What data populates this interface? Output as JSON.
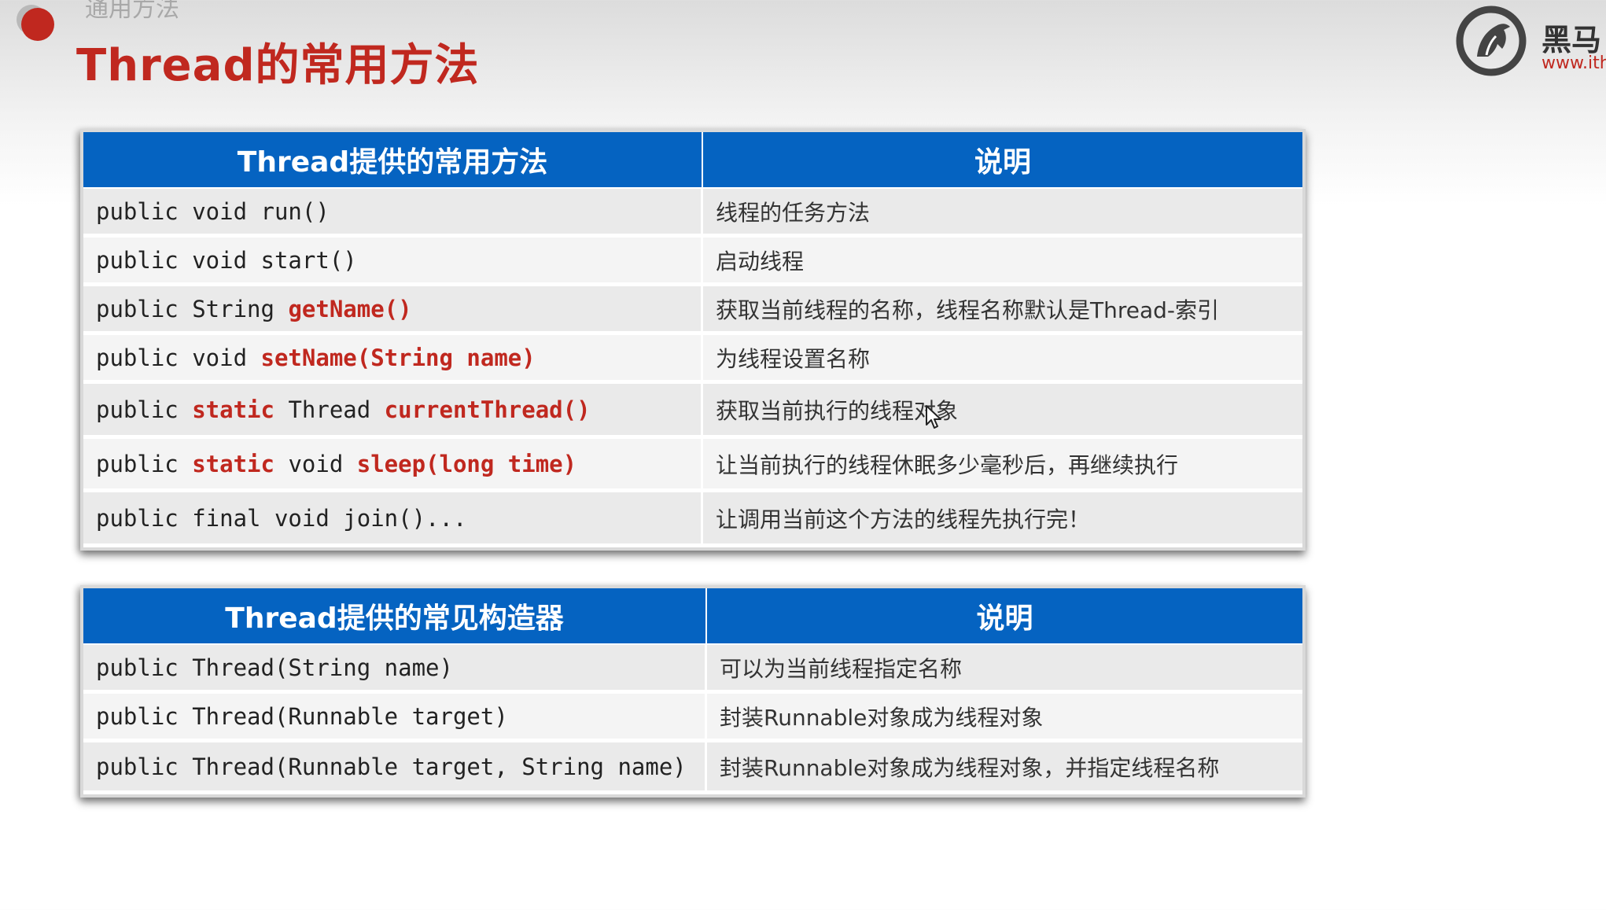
{
  "header": {
    "faded_text": "通用方法",
    "title": "Thread的常用方法"
  },
  "logo": {
    "name": "黑马",
    "url": "www.ith"
  },
  "methods_table": {
    "headers": [
      "Thread提供的常用方法",
      "说明"
    ],
    "rows": [
      {
        "code": [
          {
            "t": "public void run()",
            "hl": false
          }
        ],
        "desc": "线程的任务方法"
      },
      {
        "code": [
          {
            "t": "public void start()",
            "hl": false
          }
        ],
        "desc": "启动线程"
      },
      {
        "code": [
          {
            "t": "public String ",
            "hl": false
          },
          {
            "t": "getName()",
            "hl": true
          }
        ],
        "desc": "获取当前线程的名称，线程名称默认是Thread-索引"
      },
      {
        "code": [
          {
            "t": "public void ",
            "hl": false
          },
          {
            "t": "setName(String name)",
            "hl": true
          }
        ],
        "desc": "为线程设置名称"
      },
      {
        "code": [
          {
            "t": "public ",
            "hl": false
          },
          {
            "t": "static",
            "hl": true
          },
          {
            "t": " Thread ",
            "hl": false
          },
          {
            "t": "currentThread()",
            "hl": true
          }
        ],
        "desc": "获取当前执行的线程对象"
      },
      {
        "code": [
          {
            "t": "public ",
            "hl": false
          },
          {
            "t": "static",
            "hl": true
          },
          {
            "t": " void ",
            "hl": false
          },
          {
            "t": "sleep(long time)",
            "hl": true
          }
        ],
        "desc": "让当前执行的线程休眠多少毫秒后，再继续执行"
      },
      {
        "code": [
          {
            "t": "public final void join()...",
            "hl": false
          }
        ],
        "desc": "让调用当前这个方法的线程先执行完！"
      }
    ]
  },
  "constructors_table": {
    "headers": [
      "Thread提供的常见构造器",
      "说明"
    ],
    "rows": [
      {
        "code": [
          {
            "t": "public Thread(String name)",
            "hl": false
          }
        ],
        "desc": "可以为当前线程指定名称"
      },
      {
        "code": [
          {
            "t": "public Thread(Runnable target)",
            "hl": false
          }
        ],
        "desc": "封装Runnable对象成为线程对象"
      },
      {
        "code": [
          {
            "t": "public Thread(Runnable target, String name)",
            "hl": false
          }
        ],
        "desc": "封装Runnable对象成为线程对象，并指定线程名称"
      }
    ]
  },
  "colors": {
    "accent_red": "#c0281f",
    "header_blue": "#0563c1"
  }
}
